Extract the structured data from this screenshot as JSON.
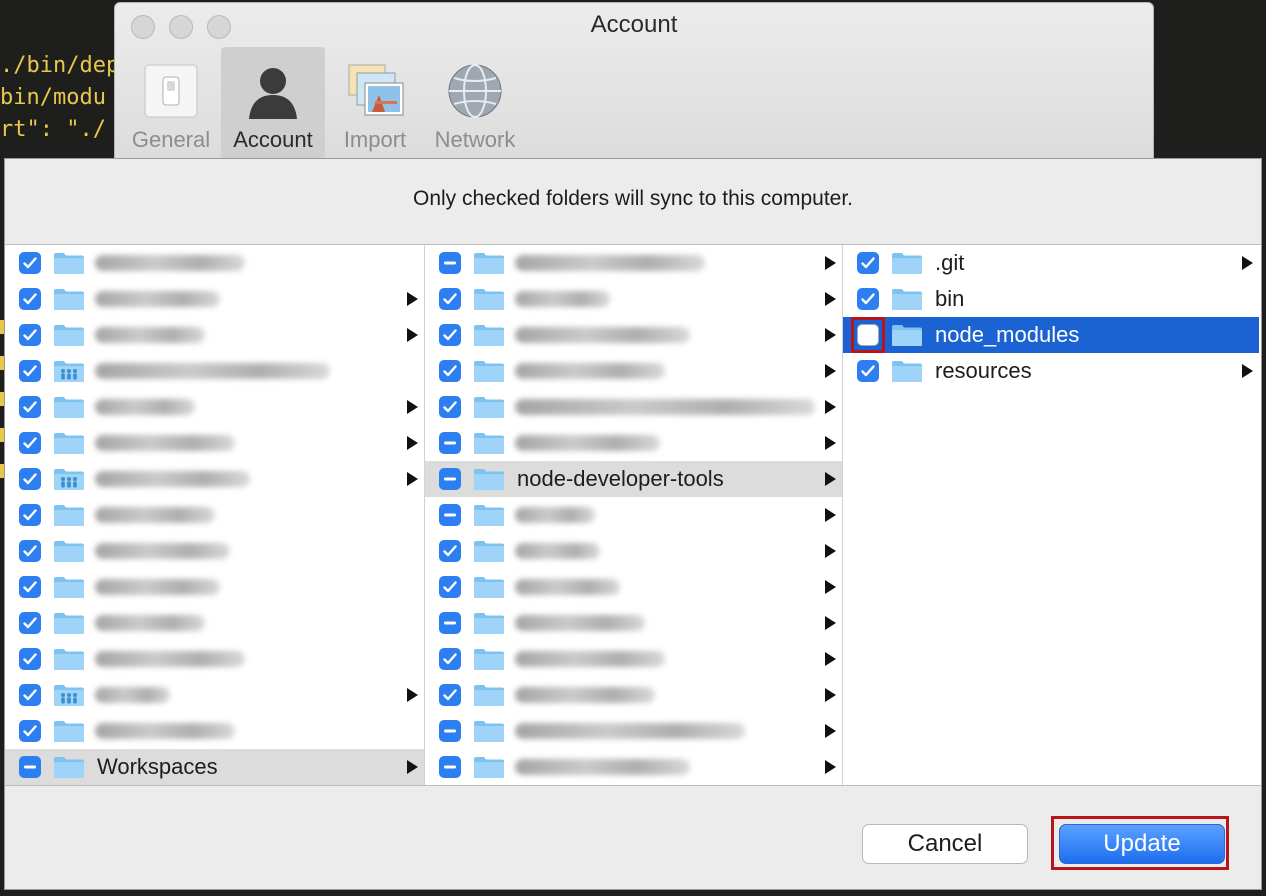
{
  "background_code": {
    "lines": [
      "./bin/dep",
      "bin/modu",
      "rt\": \"./"
    ]
  },
  "prefs": {
    "title": "Account",
    "tabs": [
      {
        "label": "General",
        "icon": "general-switch-icon"
      },
      {
        "label": "Account",
        "icon": "account-person-icon"
      },
      {
        "label": "Import",
        "icon": "import-photos-icon"
      },
      {
        "label": "Network",
        "icon": "network-globe-icon"
      }
    ]
  },
  "sheet": {
    "message": "Only checked folders will sync to this computer.",
    "col1": {
      "rows": [
        {
          "state": "checked",
          "icon": "folder",
          "blur_w": 150,
          "arrow": false
        },
        {
          "state": "checked",
          "icon": "folder",
          "blur_w": 125,
          "arrow": true
        },
        {
          "state": "checked",
          "icon": "folder",
          "blur_w": 110,
          "arrow": true
        },
        {
          "state": "checked",
          "icon": "shared-folder",
          "blur_w": 235,
          "arrow": false
        },
        {
          "state": "checked",
          "icon": "folder",
          "blur_w": 100,
          "arrow": true
        },
        {
          "state": "checked",
          "icon": "folder",
          "blur_w": 140,
          "arrow": true
        },
        {
          "state": "checked",
          "icon": "shared-folder",
          "blur_w": 155,
          "arrow": true
        },
        {
          "state": "checked",
          "icon": "folder",
          "blur_w": 120,
          "arrow": false
        },
        {
          "state": "checked",
          "icon": "folder",
          "blur_w": 135,
          "arrow": false
        },
        {
          "state": "checked",
          "icon": "folder",
          "blur_w": 125,
          "arrow": false
        },
        {
          "state": "checked",
          "icon": "folder",
          "blur_w": 110,
          "arrow": false
        },
        {
          "state": "checked",
          "icon": "folder",
          "blur_w": 150,
          "arrow": false
        },
        {
          "state": "checked",
          "icon": "shared-folder",
          "blur_w": 75,
          "arrow": true
        },
        {
          "state": "checked",
          "icon": "folder",
          "blur_w": 140,
          "arrow": false
        },
        {
          "state": "partial",
          "icon": "folder",
          "label": "Workspaces",
          "arrow": true,
          "selected": "grey"
        }
      ]
    },
    "col2": {
      "rows": [
        {
          "state": "partial",
          "blur_w": 190,
          "arrow": true
        },
        {
          "state": "checked",
          "blur_w": 95,
          "arrow": true
        },
        {
          "state": "checked",
          "blur_w": 175,
          "arrow": true
        },
        {
          "state": "checked",
          "blur_w": 150,
          "arrow": true
        },
        {
          "state": "checked",
          "blur_w": 300,
          "arrow": true
        },
        {
          "state": "partial",
          "blur_w": 145,
          "arrow": true
        },
        {
          "state": "partial",
          "label": "node-developer-tools",
          "arrow": true,
          "selected": "grey"
        },
        {
          "state": "partial",
          "blur_w": 80,
          "arrow": true
        },
        {
          "state": "checked",
          "blur_w": 85,
          "arrow": true
        },
        {
          "state": "checked",
          "blur_w": 105,
          "arrow": true
        },
        {
          "state": "partial",
          "blur_w": 130,
          "arrow": true
        },
        {
          "state": "checked",
          "blur_w": 150,
          "arrow": true
        },
        {
          "state": "checked",
          "blur_w": 140,
          "arrow": true
        },
        {
          "state": "partial",
          "blur_w": 230,
          "arrow": true
        },
        {
          "state": "partial",
          "blur_w": 175,
          "arrow": true
        }
      ]
    },
    "col3": {
      "rows": [
        {
          "state": "checked",
          "label": ".git",
          "arrow": true
        },
        {
          "state": "checked",
          "label": "bin",
          "arrow": false
        },
        {
          "state": "unchecked",
          "label": "node_modules",
          "arrow": false,
          "selected": "blue",
          "highlight": true
        },
        {
          "state": "checked",
          "label": "resources",
          "arrow": true
        }
      ]
    },
    "buttons": {
      "cancel": "Cancel",
      "update": "Update"
    }
  }
}
